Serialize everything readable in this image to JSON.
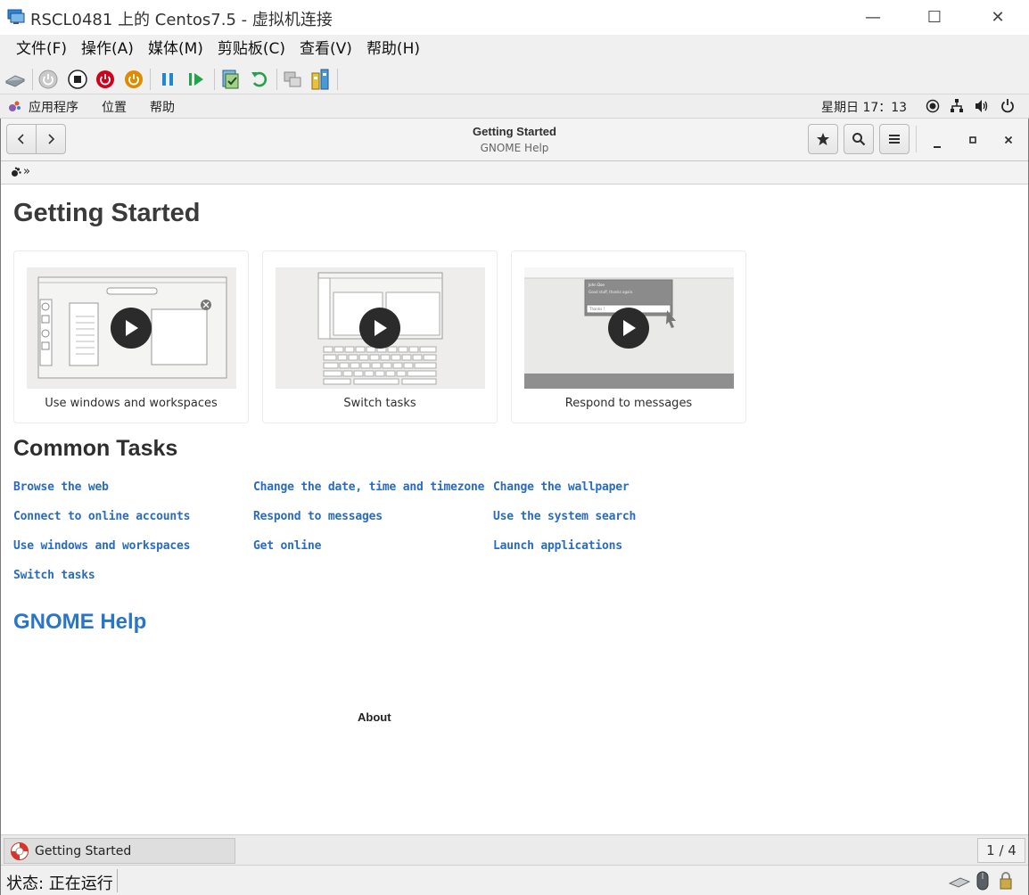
{
  "window": {
    "title": "RSCL0481 上的 Centos7.5 - 虚拟机连接",
    "minimize_glyph": "—",
    "maximize_glyph": "☐",
    "close_glyph": "✕"
  },
  "menubar": {
    "items": [
      {
        "label": "文件(F)"
      },
      {
        "label": "操作(A)"
      },
      {
        "label": "媒体(M)"
      },
      {
        "label": "剪贴板(C)"
      },
      {
        "label": "查看(V)"
      },
      {
        "label": "帮助(H)"
      }
    ]
  },
  "vm_toolbar": {
    "icons": [
      "ctrl-alt-del-icon",
      "start-icon",
      "turn-off-icon",
      "shutdown-icon",
      "save-state-icon",
      "pause-icon",
      "resume-icon",
      "checkpoint-icon",
      "revert-icon",
      "enhanced-session-icon",
      "share-icon"
    ]
  },
  "gnome_panel": {
    "applications": "应用程序",
    "places": "位置",
    "help": "帮助",
    "clock": "星期日 17：13"
  },
  "headerbar": {
    "title": "Getting Started",
    "subtitle": "GNOME Help"
  },
  "breadcrumb": {
    "separator": "»"
  },
  "page": {
    "title": "Getting Started",
    "cards": [
      {
        "caption": "Use windows and workspaces"
      },
      {
        "caption": "Switch tasks"
      },
      {
        "caption": "Respond to messages"
      }
    ],
    "common_tasks_title": "Common Tasks",
    "tasks": [
      [
        "Browse the web",
        "Change the date, time and timezone",
        "Change the wallpaper"
      ],
      [
        "Connect to online accounts",
        "Respond to messages",
        "Use the system search"
      ],
      [
        "Use windows and workspaces",
        "Get online",
        "Launch applications"
      ],
      [
        "Switch tasks"
      ]
    ],
    "gnome_help_link": "GNOME Help",
    "about": "About",
    "thumb3_notification_title": "John Doe",
    "thumb3_notification_body": "Good stuff, thanks again.",
    "thumb3_reply": "Thanks !"
  },
  "taskbar": {
    "window_label": "Getting Started",
    "pager": "1 / 4"
  },
  "statusbar": {
    "status": "状态: 正在运行"
  },
  "colors": {
    "link": "#2a6bbf",
    "help_link": "#2a76c6",
    "chrome_bg": "#f0f0f0",
    "power_red": "#d0021b",
    "power_orange": "#e08a00",
    "hyperv_blue": "#1e88d0",
    "hyperv_green": "#22a34a"
  }
}
